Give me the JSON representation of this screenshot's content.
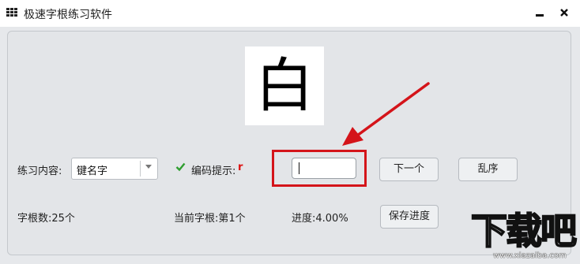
{
  "window": {
    "title": "极速字根练习软件",
    "icon": "grid-menu-icon",
    "minimize_icon": "minimize-icon",
    "close_icon": "close-icon",
    "minimize_glyph": "▬",
    "close_glyph": "✕"
  },
  "display": {
    "character": "白"
  },
  "controls": {
    "practice_label": "练习内容:",
    "practice_value": "键名字",
    "hint_label": "编码提示:",
    "hint_value": "r",
    "code_input_value": "",
    "next_button": "下一个",
    "shuffle_button": "乱序",
    "save_button": "保存进度"
  },
  "status": {
    "total_roots": "字根数:25个",
    "current_root": "当前字根:第1个",
    "progress": "进度:4.00%"
  },
  "annotation": {
    "color": "#d4141a"
  },
  "watermark": {
    "logo_text": "下载吧",
    "url": "www.xiazaiba.com"
  }
}
